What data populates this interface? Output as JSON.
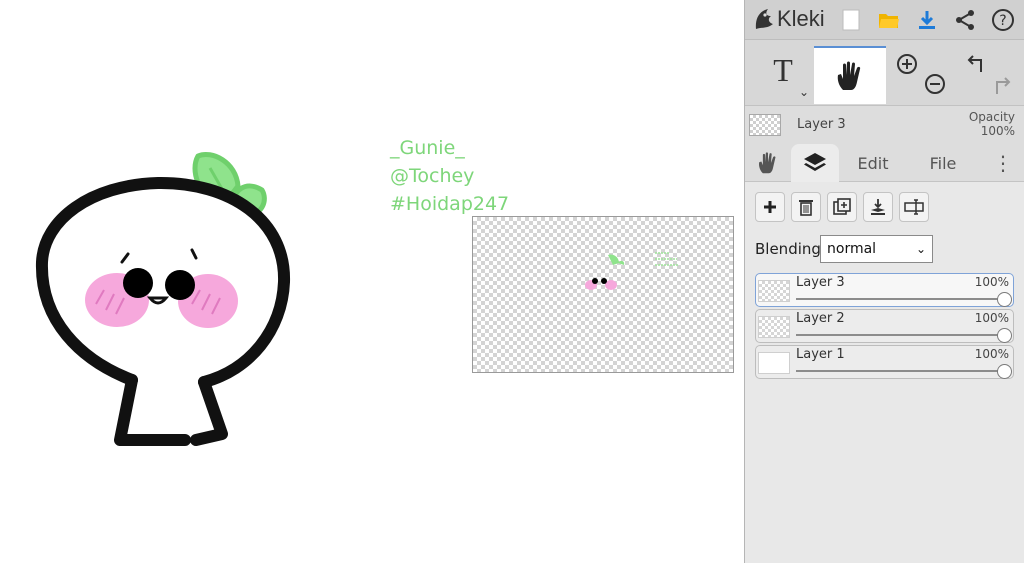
{
  "canvas": {
    "handles": [
      "_Gunie_",
      "@Tochey",
      "#Hoidap247"
    ]
  },
  "toolbar": {
    "app_name": "Kleki",
    "icons": [
      "kleki-logo-icon",
      "new-file-icon",
      "open-folder-icon",
      "download-icon",
      "share-icon",
      "help-icon"
    ],
    "accent": "#1e7bd8"
  },
  "tools": {
    "text_tool_label": "T",
    "caret": "⌄",
    "active_tool": "hand"
  },
  "layer_status": {
    "name": "Layer 3",
    "opacity_label": "Opacity",
    "opacity_value": "100%"
  },
  "tabs": {
    "edit": "Edit",
    "file": "File",
    "more": "⋮"
  },
  "layers_panel": {
    "blending_label": "Blending",
    "blending_value": "normal",
    "layers": [
      {
        "name": "Layer 3",
        "opacity": "100%",
        "opacity_fraction": 1.0,
        "active": true
      },
      {
        "name": "Layer 2",
        "opacity": "100%",
        "opacity_fraction": 1.0,
        "active": false
      },
      {
        "name": "Layer 1",
        "opacity": "100%",
        "opacity_fraction": 1.0,
        "active": false
      }
    ]
  },
  "colors": {
    "leaf_green": "#82dd82",
    "blush_pink": "#f4a7d8",
    "selection_blue": "#5a8fd4"
  }
}
